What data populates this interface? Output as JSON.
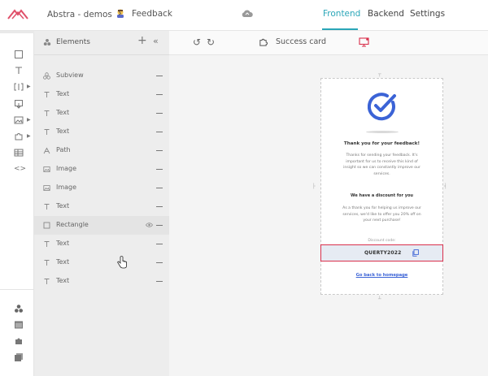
{
  "header": {
    "project": "Abstra - demos",
    "page": "Feedback",
    "tabs": [
      {
        "label": "Frontend",
        "active": true
      },
      {
        "label": "Backend",
        "active": false
      },
      {
        "label": "Settings",
        "active": false
      }
    ],
    "accent_color": "#2aa6b8"
  },
  "rail": {
    "icons": [
      "square-icon",
      "text-icon",
      "input-icon",
      "download-icon",
      "image-icon",
      "puzzle-icon",
      "table-icon",
      "code-icon"
    ],
    "bottom_icons": [
      "elements-icon",
      "layout-icon",
      "plugin-icon",
      "pages-icon"
    ]
  },
  "panel": {
    "title": "Elements",
    "layers": [
      {
        "icon": "subview-icon",
        "label": "Subview"
      },
      {
        "icon": "text-icon",
        "label": "Text"
      },
      {
        "icon": "text-icon",
        "label": "Text"
      },
      {
        "icon": "text-icon",
        "label": "Text"
      },
      {
        "icon": "path-icon",
        "label": "Path"
      },
      {
        "icon": "image-icon",
        "label": "Image"
      },
      {
        "icon": "image-icon",
        "label": "Image"
      },
      {
        "icon": "text-icon",
        "label": "Text"
      },
      {
        "icon": "rectangle-icon",
        "label": "Rectangle"
      },
      {
        "icon": "text-icon",
        "label": "Text"
      },
      {
        "icon": "text-icon",
        "label": "Text"
      },
      {
        "icon": "text-icon",
        "label": "Text"
      }
    ]
  },
  "canvas": {
    "component": "Success card",
    "card": {
      "title": "Thank you for your feedback!",
      "body": "Thanks for sending your feedback. It's important for us to receive this kind of insight so we can constantly improve our services.",
      "subtitle": "We have a discount for you",
      "body2": "As a thank you for helping us improve our services, we'd like to offer you 20% off on your next purchase!",
      "discount_label": "Discount code:",
      "code": "QUERTY2022",
      "link": "Go back to homepage",
      "check_color": "#3b63d6",
      "selection_color": "#d9304c"
    }
  }
}
